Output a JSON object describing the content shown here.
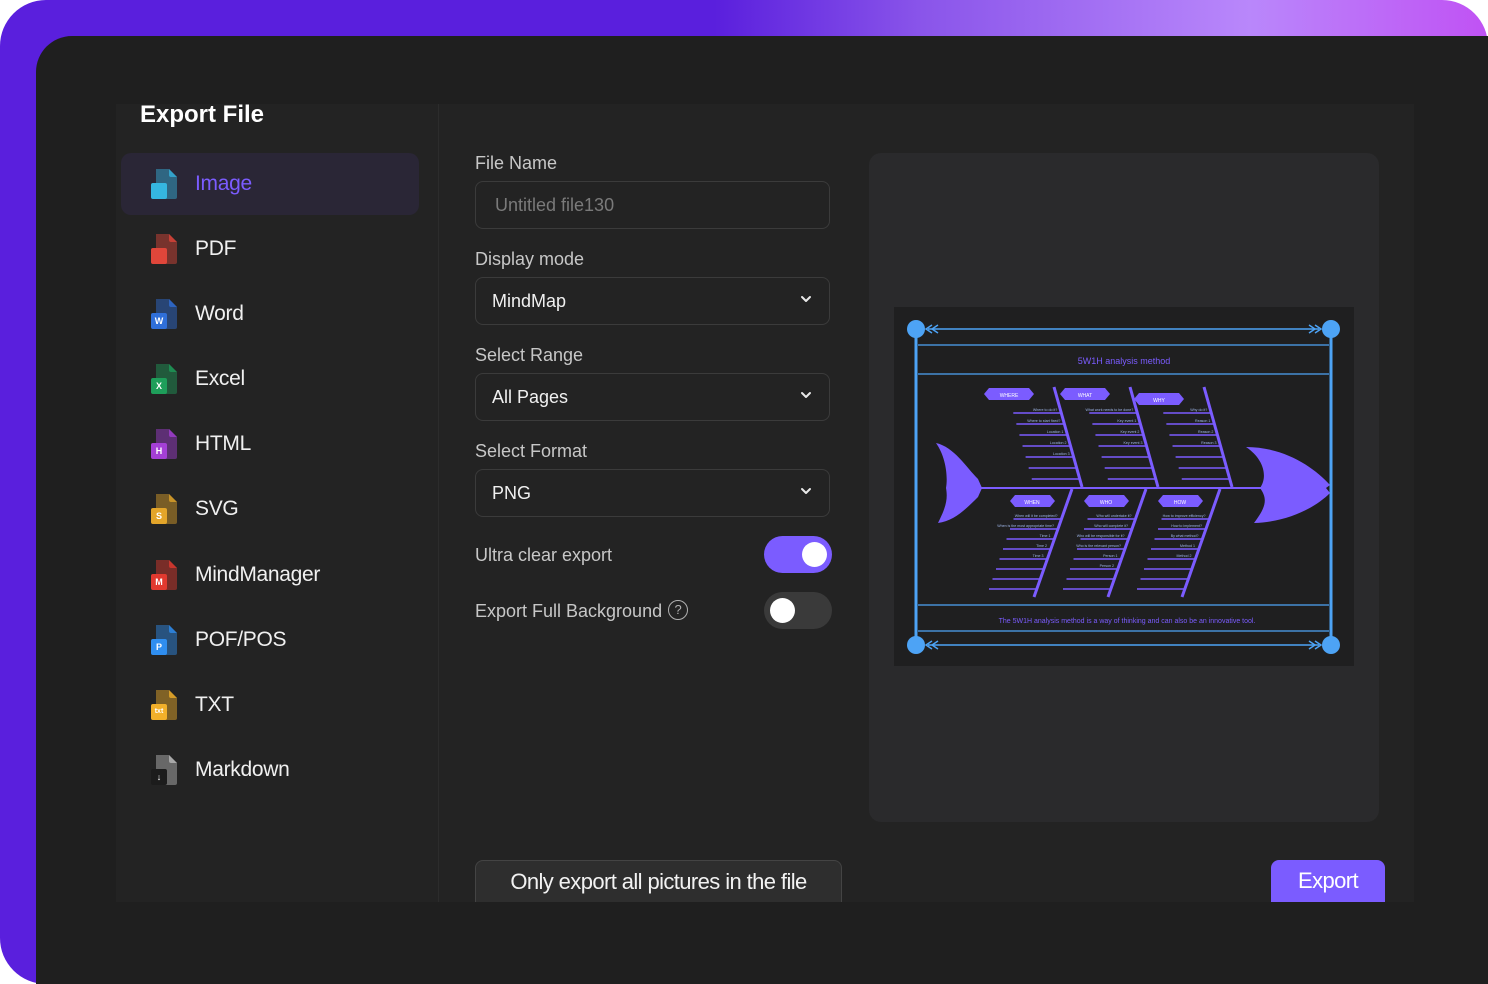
{
  "dialog": {
    "title": "Export File"
  },
  "sidebar": {
    "items": [
      {
        "label": "Image",
        "icon": "image-file-icon",
        "color": "#35b6e0",
        "letter": "",
        "active": true
      },
      {
        "label": "PDF",
        "icon": "pdf-file-icon",
        "color": "#e0463a",
        "letter": "",
        "active": false
      },
      {
        "label": "Word",
        "icon": "word-file-icon",
        "color": "#2f6fd9",
        "letter": "W",
        "active": false
      },
      {
        "label": "Excel",
        "icon": "excel-file-icon",
        "color": "#1e9e5a",
        "letter": "X",
        "active": false
      },
      {
        "label": "HTML",
        "icon": "html-file-icon",
        "color": "#a43fd6",
        "letter": "H",
        "active": false
      },
      {
        "label": "SVG",
        "icon": "svg-file-icon",
        "color": "#e3a52a",
        "letter": "S",
        "active": false
      },
      {
        "label": "MindManager",
        "icon": "mindmanager-file-icon",
        "color": "#e2392f",
        "letter": "M",
        "active": false
      },
      {
        "label": "POF/POS",
        "icon": "pof-pos-file-icon",
        "color": "#2f8ef0",
        "letter": "P",
        "active": false
      },
      {
        "label": "TXT",
        "icon": "txt-file-icon",
        "color": "#f2b02a",
        "letter": "txt",
        "active": false
      },
      {
        "label": "Markdown",
        "icon": "markdown-file-icon",
        "color": "#1c1c1c",
        "letter": "↓",
        "active": false
      }
    ]
  },
  "form": {
    "file_name_label": "File Name",
    "file_name_placeholder": "Untitled file130",
    "file_name_value": "",
    "display_mode_label": "Display mode",
    "display_mode_value": "MindMap",
    "select_range_label": "Select Range",
    "select_range_value": "All Pages",
    "select_format_label": "Select Format",
    "select_format_value": "PNG",
    "ultra_clear_label": "Ultra clear export",
    "ultra_clear_on": true,
    "full_background_label": "Export Full Background",
    "full_background_on": false,
    "help_glyph": "?"
  },
  "preview": {
    "title": "5W1H analysis method",
    "footer": "The 5W1H analysis method is a way of thinking and can also be an innovative tool.",
    "colors": {
      "accent": "#7b5cff",
      "frame": "#4da3f5",
      "bg": "#1f1f20"
    },
    "branches_top": [
      {
        "label": "WHERE",
        "items": [
          "Where to do it?",
          "Where to start fixed?",
          "Location 1",
          "Location 2",
          "Location 3"
        ]
      },
      {
        "label": "WHAT",
        "items": [
          "What work needs to be done?",
          "Key event 1",
          "Key event 2",
          "Key event 3"
        ]
      },
      {
        "label": "WHY",
        "items": [
          "Why do it?",
          "Reason 1",
          "Reason 2",
          "Reason 3"
        ]
      }
    ],
    "branches_bottom": [
      {
        "label": "WHEN",
        "items": [
          "When will it be completed?",
          "When is the most appropriate time?",
          "Time 1",
          "Time 2",
          "Time 3"
        ]
      },
      {
        "label": "WHO",
        "items": [
          "Who will undertake it?",
          "Who will complete it?",
          "Who will be responsible for it?",
          "Who is the relevant person?",
          "Person 1",
          "Person 2"
        ]
      },
      {
        "label": "HOW",
        "items": [
          "How to improve efficiency?",
          "How to implement?",
          "By what method?",
          "Method 1",
          "Method 2"
        ]
      }
    ]
  },
  "footer": {
    "only_pictures_label": "Only export all pictures in the file",
    "export_label": "Export"
  }
}
